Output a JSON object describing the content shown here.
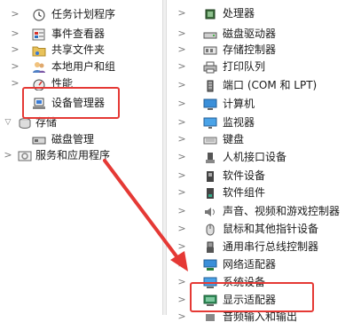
{
  "left_tree": {
    "items": [
      {
        "label": "任务计划程序",
        "icon": "clock-icon"
      },
      {
        "label": "事件查看器",
        "icon": "event-viewer-icon"
      },
      {
        "label": "共享文件夹",
        "icon": "shared-folder-icon"
      },
      {
        "label": "本地用户和组",
        "icon": "users-icon"
      },
      {
        "label": "性能",
        "icon": "performance-icon"
      },
      {
        "label": "设备管理器",
        "icon": "device-manager-icon"
      },
      {
        "label": "存储",
        "icon": "storage-icon"
      },
      {
        "label": "磁盘管理",
        "icon": "disk-management-icon"
      },
      {
        "label": "服务和应用程序",
        "icon": "services-icon"
      }
    ]
  },
  "right_tree": {
    "items": [
      {
        "label": "处理器",
        "icon": "processor-icon"
      },
      {
        "label": "磁盘驱动器",
        "icon": "disk-drive-icon"
      },
      {
        "label": "存储控制器",
        "icon": "storage-controller-icon"
      },
      {
        "label": "打印队列",
        "icon": "printer-icon"
      },
      {
        "label": "端口 (COM 和 LPT)",
        "icon": "port-icon"
      },
      {
        "label": "计算机",
        "icon": "computer-icon"
      },
      {
        "label": "监视器",
        "icon": "monitor-icon"
      },
      {
        "label": "键盘",
        "icon": "keyboard-icon"
      },
      {
        "label": "人机接口设备",
        "icon": "hid-icon"
      },
      {
        "label": "软件设备",
        "icon": "software-device-icon"
      },
      {
        "label": "软件组件",
        "icon": "software-component-icon"
      },
      {
        "label": "声音、视频和游戏控制器",
        "icon": "sound-icon"
      },
      {
        "label": "鼠标和其他指针设备",
        "icon": "mouse-icon"
      },
      {
        "label": "通用串行总线控制器",
        "icon": "usb-icon"
      },
      {
        "label": "网络适配器",
        "icon": "network-adapter-icon"
      },
      {
        "label": "系统设备",
        "icon": "system-device-icon"
      },
      {
        "label": "显示适配器",
        "icon": "display-adapter-icon"
      },
      {
        "label": "音频输入和输出",
        "icon": "audio-io-icon"
      }
    ]
  },
  "annotation": {
    "color": "#e53935",
    "highlighted_left": "设备管理器",
    "highlighted_right": "显示适配器"
  }
}
